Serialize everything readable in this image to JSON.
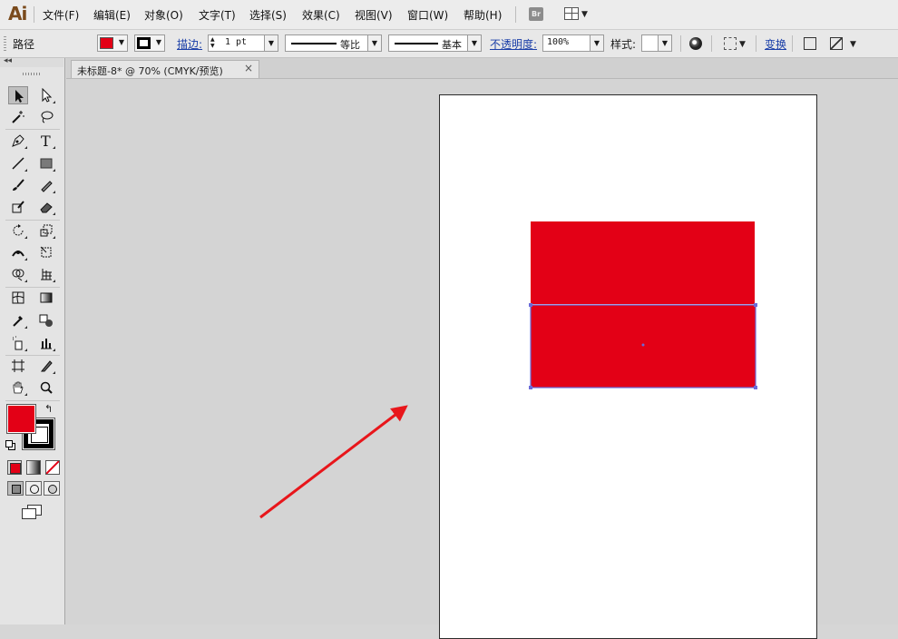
{
  "app": {
    "logo": "Ai",
    "menu": [
      "文件(F)",
      "编辑(E)",
      "对象(O)",
      "文字(T)",
      "选择(S)",
      "效果(C)",
      "视图(V)",
      "窗口(W)",
      "帮助(H)"
    ],
    "bridge_label": "Br"
  },
  "control_bar": {
    "object_type": "路径",
    "fill_color": "#e30016",
    "stroke_label": "描边:",
    "stroke_weight": "1 pt",
    "stroke_profile": "等比",
    "brush_definition": "基本",
    "opacity_label": "不透明度:",
    "opacity_value": "100%",
    "style_label": "样式:",
    "transform_label": "变换"
  },
  "document": {
    "tab_title": "未标题-8* @ 70% (CMYK/预览)",
    "close_glyph": "×"
  },
  "tools": {
    "fill_color": "#e30016",
    "stroke_color": "#000000"
  },
  "canvas": {
    "shape_fill": "#e30016",
    "selection_color": "#6a6ad8",
    "arrow_color": "#e8161b"
  }
}
